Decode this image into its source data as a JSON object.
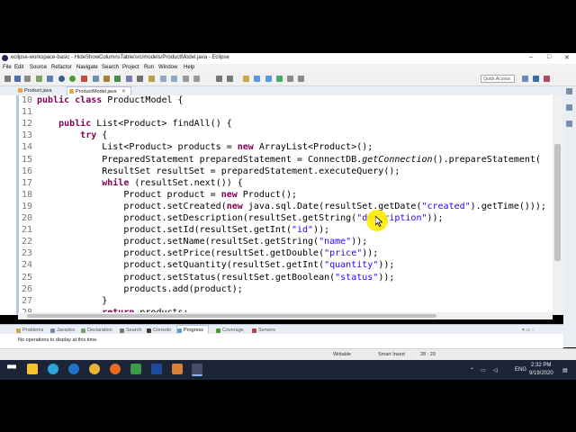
{
  "window": {
    "title": "eclipse-workspace-basic - HideShowColumnsTable/src/models/ProductModel.java - Eclipse",
    "controls": [
      "–",
      "□",
      "✕"
    ]
  },
  "menu": [
    "File",
    "Edit",
    "Source",
    "Refactor",
    "Navigate",
    "Search",
    "Project",
    "Run",
    "Window",
    "Help"
  ],
  "toolbar": {
    "quick_access": "Quick Access"
  },
  "tabs": [
    {
      "label": "Product.java",
      "active": false
    },
    {
      "label": "ProductModel.java",
      "active": true
    }
  ],
  "tab_close": "✕",
  "code": {
    "lines": [
      {
        "n": "10",
        "text": "public class ProductModel {"
      },
      {
        "n": "11",
        "text": ""
      },
      {
        "n": "12",
        "text": "    public List<Product> findAll() {"
      },
      {
        "n": "13",
        "text": "        try {"
      },
      {
        "n": "14",
        "text": "            List<Product> products = new ArrayList<Product>();"
      },
      {
        "n": "15",
        "text": "            PreparedStatement preparedStatement = ConnectDB.getConnection().prepareStatement("
      },
      {
        "n": "16",
        "text": "            ResultSet resultSet = preparedStatement.executeQuery();"
      },
      {
        "n": "17",
        "text": "            while (resultSet.next()) {"
      },
      {
        "n": "18",
        "text": "                Product product = new Product();"
      },
      {
        "n": "19",
        "text": "                product.setCreated(new java.sql.Date(resultSet.getDate(\"created\").getTime()));"
      },
      {
        "n": "20",
        "text": "                product.setDescription(resultSet.getString(\"description\"));"
      },
      {
        "n": "21",
        "text": "                product.setId(resultSet.getInt(\"id\"));"
      },
      {
        "n": "22",
        "text": "                product.setName(resultSet.getString(\"name\"));"
      },
      {
        "n": "23",
        "text": "                product.setPrice(resultSet.getDouble(\"price\"));"
      },
      {
        "n": "24",
        "text": "                product.setQuantity(resultSet.getInt(\"quantity\"));"
      },
      {
        "n": "25",
        "text": "                product.setStatus(resultSet.getBoolean(\"status\"));"
      },
      {
        "n": "26",
        "text": "                products.add(product);"
      },
      {
        "n": "27",
        "text": "            }"
      },
      {
        "n": "28",
        "text": "            return products;"
      }
    ]
  },
  "bottom_tabs": [
    "Problems",
    "Javadoc",
    "Declaration",
    "Search",
    "Console",
    "Progress",
    "Coverage",
    "Servers"
  ],
  "bottom_active": "Progress",
  "bottom_message": "No operations to display at this time.",
  "status": {
    "mode": "Writable",
    "insert": "Smart Insert",
    "position": "28 : 29"
  },
  "taskbar": {
    "time": "2:32 PM",
    "date": "9/19/2020",
    "lang": "ENG"
  },
  "colors": {
    "keyword": "#7f0055",
    "string": "#2a00ff",
    "field": "#0000c0",
    "highlight": "#ffec00"
  }
}
